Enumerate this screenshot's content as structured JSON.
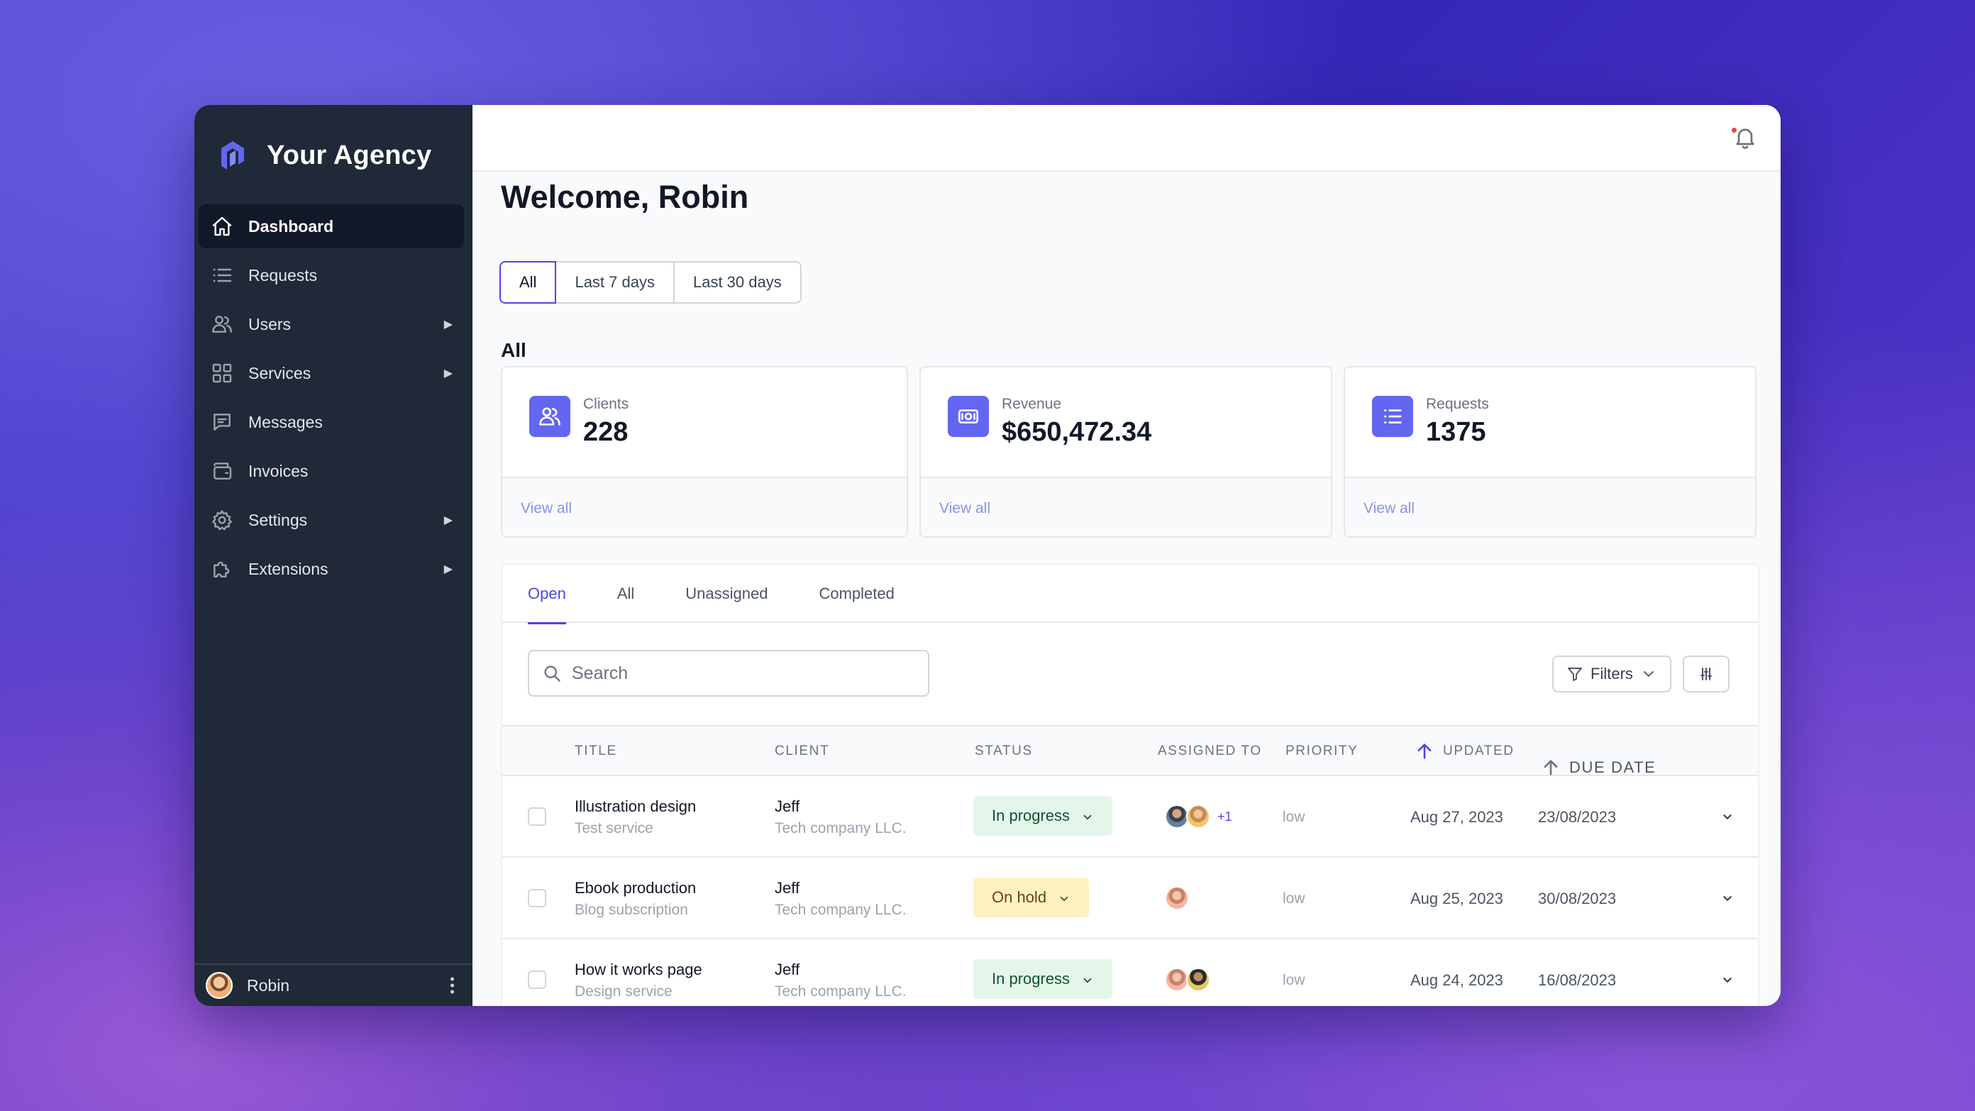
{
  "brand": {
    "name": "Your Agency",
    "accent": "#4f46e5"
  },
  "sidebar": {
    "items": [
      {
        "label": "Dashboard",
        "icon": "home-icon",
        "active": true
      },
      {
        "label": "Requests",
        "icon": "list-icon"
      },
      {
        "label": "Users",
        "icon": "users-icon",
        "expandable": true
      },
      {
        "label": "Services",
        "icon": "grid-icon",
        "expandable": true
      },
      {
        "label": "Messages",
        "icon": "message-icon"
      },
      {
        "label": "Invoices",
        "icon": "wallet-icon"
      },
      {
        "label": "Settings",
        "icon": "gear-icon",
        "expandable": true
      },
      {
        "label": "Extensions",
        "icon": "puzzle-icon",
        "expandable": true
      }
    ],
    "user": {
      "name": "Robin"
    }
  },
  "header": {
    "welcome": "Welcome, Robin"
  },
  "range": {
    "options": [
      "All",
      "Last 7 days",
      "Last 30 days"
    ],
    "selected": "All"
  },
  "section": {
    "label": "All"
  },
  "stats": [
    {
      "label": "Clients",
      "value": "228",
      "link": "View all",
      "icon": "users-icon"
    },
    {
      "label": "Revenue",
      "value": "$650,472.34",
      "link": "View all",
      "icon": "cash-icon"
    },
    {
      "label": "Requests",
      "value": "1375",
      "link": "View all",
      "icon": "list-icon"
    }
  ],
  "tabs": [
    "Open",
    "All",
    "Unassigned",
    "Completed"
  ],
  "toolbar": {
    "search_placeholder": "Search",
    "filters_label": "Filters"
  },
  "table": {
    "columns": [
      "Title",
      "Client",
      "Status",
      "Assigned to",
      "Priority",
      "Updated",
      "Due date"
    ],
    "rows": [
      {
        "title": "Illustration design",
        "service": "Test service",
        "client": "Jeff",
        "company": "Tech company LLC.",
        "status": "In progress",
        "status_type": "progress",
        "assignees_extra": "+1",
        "priority": "low",
        "updated": "Aug 27, 2023",
        "due": "23/08/2023"
      },
      {
        "title": "Ebook production",
        "service": "Blog subscription",
        "client": "Jeff",
        "company": "Tech company LLC.",
        "status": "On hold",
        "status_type": "hold",
        "assignees_extra": "",
        "priority": "low",
        "updated": "Aug 25, 2023",
        "due": "30/08/2023"
      },
      {
        "title": "How it works page",
        "service": "Design service",
        "client": "Jeff",
        "company": "Tech company LLC.",
        "status": "In progress",
        "status_type": "progress",
        "assignees_extra": "",
        "priority": "low",
        "updated": "Aug 24, 2023",
        "due": "16/08/2023"
      }
    ]
  }
}
